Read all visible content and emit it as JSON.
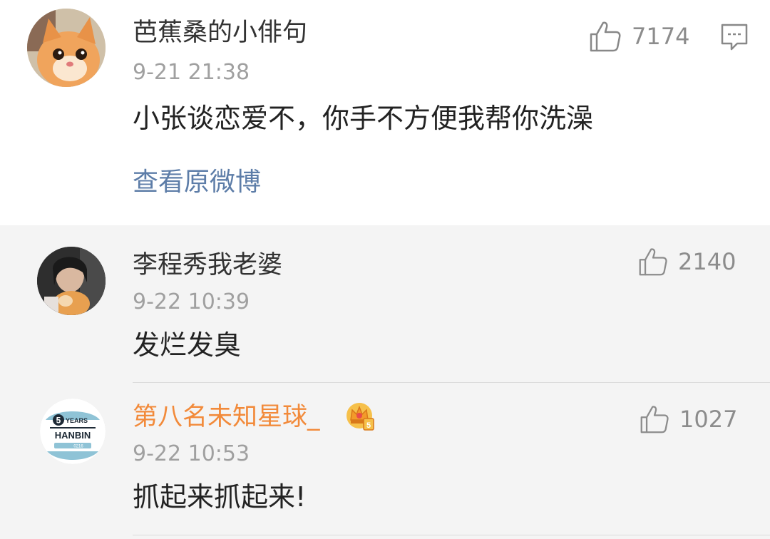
{
  "comment": {
    "username": "芭蕉桑的小俳句",
    "time": "9-21 21:38",
    "text": "小张谈恋爱不，你手不方便我帮你洗澡",
    "likes": "7174",
    "view_original": "查看原微博",
    "avatar_icon": "cat-avatar-icon",
    "like_icon": "thumbs-up-icon",
    "reply_icon": "comment-bubble-icon"
  },
  "replies": [
    {
      "username": "李程秀我老婆",
      "time": "9-22 10:39",
      "text": "发烂发臭",
      "likes": "2140",
      "avatar_icon": "person-with-cat-avatar-icon"
    },
    {
      "username": "第八名未知星球_",
      "time": "9-22 10:53",
      "text": "抓起来抓起来!",
      "likes": "1027",
      "avatar_icon": "hanbin-5-years-badge-avatar-icon",
      "avatar_text": {
        "number": "5",
        "years": "YEARS",
        "name": "HANBIN",
        "date": "0216"
      },
      "badge_icon": "crown-badge-icon",
      "username_color": "#f28a3a"
    }
  ],
  "colors": {
    "link": "#5d7da8",
    "timestamp": "#a0a0a0",
    "reply_bg": "#f4f4f4",
    "main_bg": "#ffffff"
  }
}
